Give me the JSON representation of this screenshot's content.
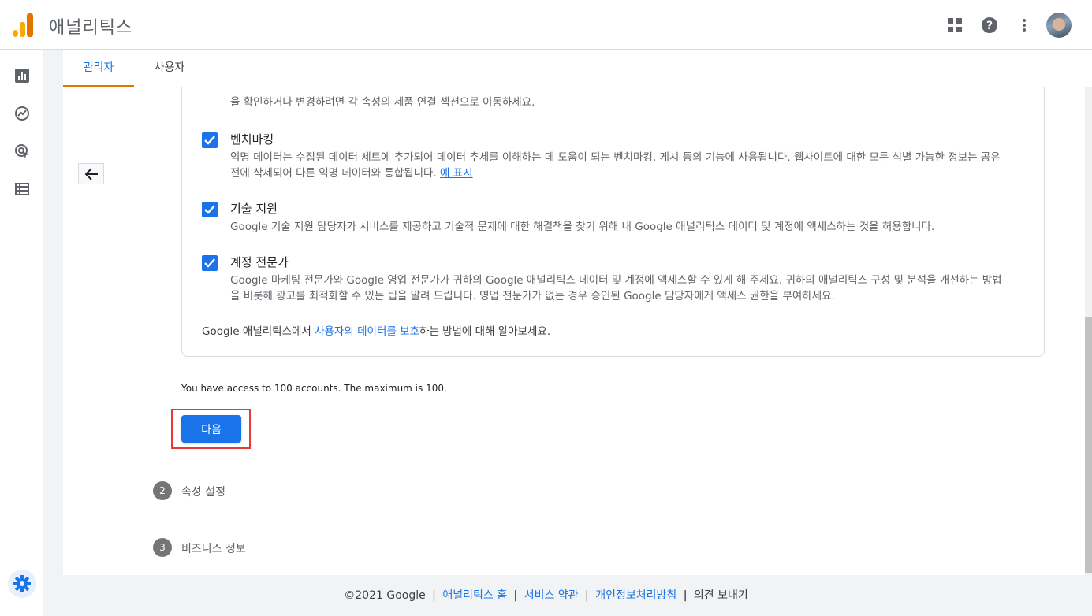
{
  "header": {
    "app_title": "애널리틱스",
    "icons": [
      "apps-grid-icon",
      "help-icon",
      "more-vert-icon",
      "account-avatar"
    ]
  },
  "rail": {
    "items": [
      "reports-icon",
      "explore-icon",
      "advertising-icon",
      "configure-icon"
    ],
    "settings_icon": "gear-icon"
  },
  "tabs": [
    {
      "label": "관리자",
      "active": true
    },
    {
      "label": "사용자",
      "active": false
    }
  ],
  "card": {
    "top_partial_text": "을 확인하거나 변경하려면 각 속성의 제품 연결 섹션으로 이동하세요.",
    "options": [
      {
        "title": "벤치마킹",
        "checked": true,
        "desc": "익명 데이터는 수집된 데이터 세트에 추가되어 데이터 추세를 이해하는 데 도움이 되는 벤치마킹, 게시 등의 기능에 사용됩니다. 웹사이트에 대한 모든 식별 가능한 정보는 공유 전에 삭제되어 다른 익명 데이터와 통합됩니다.",
        "link": "예 표시"
      },
      {
        "title": "기술 지원",
        "checked": true,
        "desc": "Google 기술 지원 담당자가 서비스를 제공하고 기술적 문제에 대한 해결책을 찾기 위해 내 Google 애널리틱스 데이터 및 계정에 액세스하는 것을 허용합니다."
      },
      {
        "title": "계정 전문가",
        "checked": true,
        "desc": "Google 마케팅 전문가와 Google 영업 전문가가 귀하의 Google 애널리틱스 데이터 및 계정에 액세스할 수 있게 해 주세요. 귀하의 애널리틱스 구성 및 분석을 개선하는 방법을 비롯해 광고를 최적화할 수 있는 팁을 알려 드립니다. 영업 전문가가 없는 경우 승인된 Google 담당자에게 액세스 권한을 부여하세요."
      }
    ],
    "footer_prefix": "Google 애널리틱스에서 ",
    "footer_link": "사용자의 데이터를 보호",
    "footer_suffix": "하는 방법에 대해 알아보세요."
  },
  "access_text": "You have access to 100 accounts. The maximum is 100.",
  "next_button": "다음",
  "steps": [
    {
      "num": "2",
      "label": "속성 설정"
    },
    {
      "num": "3",
      "label": "비즈니스 정보"
    }
  ],
  "footer": {
    "copyright": "©2021 Google",
    "links": [
      "애널리틱스 홈",
      "서비스 약관",
      "개인정보처리방침"
    ],
    "feedback": "의견 보내기"
  },
  "colors": {
    "accent": "#1a73e8",
    "tab_indicator": "#e37400",
    "highlight": "#e53935",
    "logo": "#f9ab00"
  }
}
